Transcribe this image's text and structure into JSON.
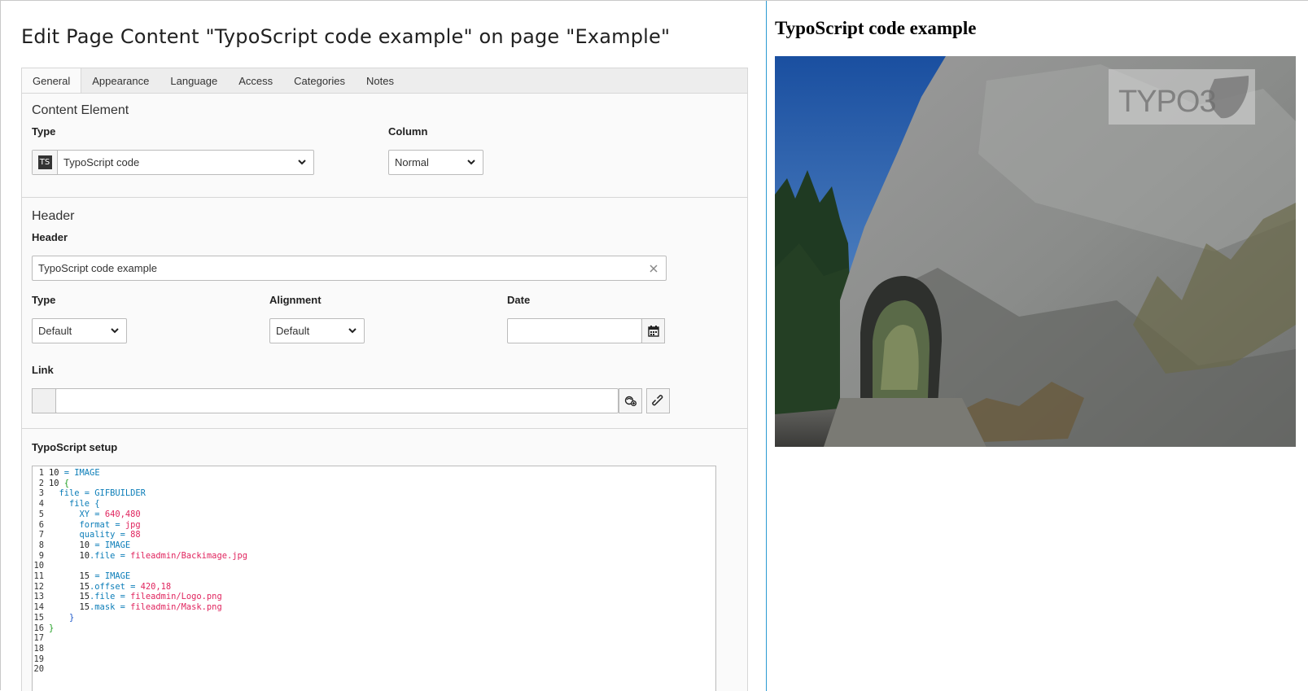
{
  "editor": {
    "title": "Edit Page Content \"TypoScript code example\" on page \"Example\"",
    "tabs": [
      {
        "label": "General",
        "active": true
      },
      {
        "label": "Appearance"
      },
      {
        "label": "Language"
      },
      {
        "label": "Access"
      },
      {
        "label": "Categories"
      },
      {
        "label": "Notes"
      }
    ],
    "content_element": {
      "section_title": "Content Element",
      "type_label": "Type",
      "type_icon": "TS",
      "type_value": "TypoScript code",
      "column_label": "Column",
      "column_value": "Normal"
    },
    "header": {
      "section_title": "Header",
      "header_label": "Header",
      "header_value": "TypoScript code example",
      "type_label": "Type",
      "type_value": "Default",
      "alignment_label": "Alignment",
      "alignment_value": "Default",
      "date_label": "Date",
      "date_value": "",
      "link_label": "Link",
      "link_value": ""
    },
    "typoscript": {
      "label": "TypoScript setup",
      "lines": [
        {
          "n": "1",
          "text": "10 = IMAGE"
        },
        {
          "n": "2",
          "text": "10 {"
        },
        {
          "n": "3",
          "text": "  file = GIFBUILDER"
        },
        {
          "n": "4",
          "text": "    file {"
        },
        {
          "n": "5",
          "text": "      XY = 640,480"
        },
        {
          "n": "6",
          "text": "      format = jpg"
        },
        {
          "n": "7",
          "text": "      quality = 88"
        },
        {
          "n": "8",
          "text": "      10 = IMAGE"
        },
        {
          "n": "9",
          "text": "      10.file = fileadmin/Backimage.jpg"
        },
        {
          "n": "10",
          "text": ""
        },
        {
          "n": "11",
          "text": "      15 = IMAGE"
        },
        {
          "n": "12",
          "text": "      15.offset = 420,18"
        },
        {
          "n": "13",
          "text": "      15.file = fileadmin/Logo.png"
        },
        {
          "n": "14",
          "text": "      15.mask = fileadmin/Mask.png"
        },
        {
          "n": "15",
          "text": "    }"
        },
        {
          "n": "16",
          "text": "}"
        },
        {
          "n": "17",
          "text": ""
        },
        {
          "n": "18",
          "text": ""
        },
        {
          "n": "19",
          "text": ""
        },
        {
          "n": "20",
          "text": ""
        }
      ]
    }
  },
  "preview": {
    "title": "TypoScript code example",
    "image_watermark": "TYPO3"
  }
}
